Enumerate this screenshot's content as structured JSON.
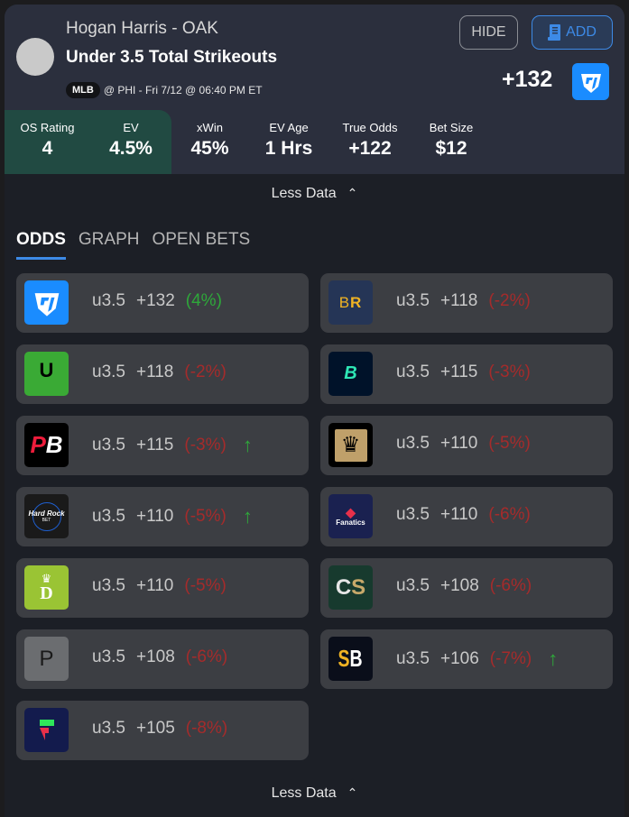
{
  "header": {
    "player": "Hogan Harris - OAK",
    "market": "Under 3.5 Total Strikeouts",
    "league": "MLB",
    "game_info": "@ PHI - Fri 7/12 @ 06:40 PM ET",
    "hide_label": "HIDE",
    "add_label": "ADD",
    "best_odds": "+132",
    "best_book": "FanDuel"
  },
  "stats": [
    {
      "label": "OS Rating",
      "value": "4"
    },
    {
      "label": "EV",
      "value": "4.5%"
    },
    {
      "label": "xWin",
      "value": "45%"
    },
    {
      "label": "EV Age",
      "value": "1 Hrs"
    },
    {
      "label": "True Odds",
      "value": "+122"
    },
    {
      "label": "Bet Size",
      "value": "$12"
    }
  ],
  "toggle_label": "Less Data",
  "tabs": [
    {
      "label": "ODDS",
      "active": true
    },
    {
      "label": "GRAPH",
      "active": false
    },
    {
      "label": "OPEN BETS",
      "active": false
    }
  ],
  "books": [
    {
      "name": "FanDuel",
      "line": "u3.5",
      "odds": "+132",
      "ev": "(4%)",
      "ev_positive": true,
      "arrow": false
    },
    {
      "name": "BetRivers",
      "line": "u3.5",
      "odds": "+118",
      "ev": "(-2%)",
      "ev_positive": false,
      "arrow": false
    },
    {
      "name": "Unibet",
      "line": "u3.5",
      "odds": "+118",
      "ev": "(-2%)",
      "ev_positive": false,
      "arrow": false
    },
    {
      "name": "ESPN Bet",
      "line": "u3.5",
      "odds": "+115",
      "ev": "(-3%)",
      "ev_positive": false,
      "arrow": false
    },
    {
      "name": "PointsBet",
      "line": "u3.5",
      "odds": "+115",
      "ev": "(-3%)",
      "ev_positive": false,
      "arrow": true
    },
    {
      "name": "BetMGM",
      "line": "u3.5",
      "odds": "+110",
      "ev": "(-5%)",
      "ev_positive": false,
      "arrow": false
    },
    {
      "name": "Hard Rock Bet",
      "line": "u3.5",
      "odds": "+110",
      "ev": "(-5%)",
      "ev_positive": false,
      "arrow": true
    },
    {
      "name": "Fanatics",
      "line": "u3.5",
      "odds": "+110",
      "ev": "(-6%)",
      "ev_positive": false,
      "arrow": false
    },
    {
      "name": "DraftKings",
      "line": "u3.5",
      "odds": "+110",
      "ev": "(-5%)",
      "ev_positive": false,
      "arrow": false
    },
    {
      "name": "Caesars",
      "line": "u3.5",
      "odds": "+108",
      "ev": "(-6%)",
      "ev_positive": false,
      "arrow": false
    },
    {
      "name": "Pinnacle",
      "line": "u3.5",
      "odds": "+108",
      "ev": "(-6%)",
      "ev_positive": false,
      "arrow": false
    },
    {
      "name": "SuperBook",
      "line": "u3.5",
      "odds": "+106",
      "ev": "(-7%)",
      "ev_positive": false,
      "arrow": true
    },
    {
      "name": "Fliff",
      "line": "u3.5",
      "odds": "+105",
      "ev": "(-8%)",
      "ev_positive": false,
      "arrow": false
    }
  ],
  "colors": {
    "accent": "#3d8ae6",
    "positive": "#2ea83a",
    "negative": "#a52b2b",
    "highlight_bg": "#214a42"
  }
}
